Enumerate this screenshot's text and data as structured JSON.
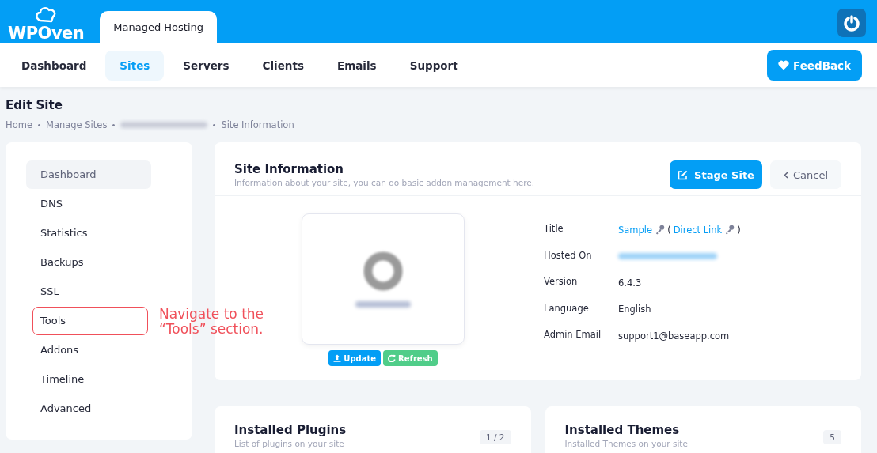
{
  "header": {
    "logo": "WPOven",
    "product_tab": "Managed Hosting"
  },
  "nav": {
    "items": [
      {
        "label": "Dashboard",
        "selected": false
      },
      {
        "label": "Sites",
        "selected": true
      },
      {
        "label": "Servers",
        "selected": false
      },
      {
        "label": "Clients",
        "selected": false
      },
      {
        "label": "Emails",
        "selected": false
      },
      {
        "label": "Support",
        "selected": false
      }
    ],
    "feedback": "FeedBack"
  },
  "page": {
    "title": "Edit Site",
    "breadcrumb": [
      "Home",
      "Manage Sites",
      "Site Information"
    ]
  },
  "sidebar": {
    "items": [
      {
        "label": "Dashboard",
        "selected": true
      },
      {
        "label": "DNS",
        "selected": false
      },
      {
        "label": "Statistics",
        "selected": false
      },
      {
        "label": "Backups",
        "selected": false
      },
      {
        "label": "SSL",
        "selected": false
      },
      {
        "label": "Tools",
        "selected": false,
        "annotated": true
      },
      {
        "label": "Addons",
        "selected": false
      },
      {
        "label": "Timeline",
        "selected": false
      },
      {
        "label": "Advanced",
        "selected": false
      }
    ]
  },
  "annotation": {
    "text": "Navigate to the “Tools” section."
  },
  "site_info": {
    "title": "Site Information",
    "subtitle": "Information about your site, you can do basic addon management here.",
    "stage": "Stage Site",
    "cancel": "Cancel",
    "update": "Update",
    "refresh": "Refresh",
    "fields": [
      {
        "kind": "title",
        "label": "Title",
        "value": "Sample",
        "open": "(",
        "link": "Direct Link",
        "close": ")"
      },
      {
        "kind": "blurred",
        "label": "Hosted On"
      },
      {
        "kind": "text",
        "label": "Version",
        "value": "6.4.3"
      },
      {
        "kind": "text",
        "label": "Language",
        "value": "English"
      },
      {
        "kind": "text",
        "label": "Admin Email",
        "value": "support1@baseapp.com"
      }
    ]
  },
  "cards": [
    {
      "title": "Installed Plugins",
      "subtitle": "List of plugins on your site",
      "count": "1 / 2"
    },
    {
      "title": "Installed Themes",
      "subtitle": "Installed Themes on your site",
      "count": "5"
    }
  ]
}
